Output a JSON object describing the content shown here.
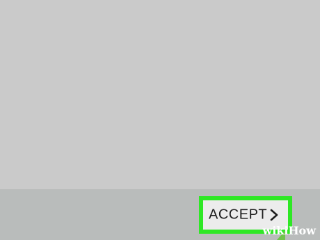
{
  "dialog": {
    "accept_label": "ACCEPT"
  },
  "icons": {
    "accept_chevron": "chevron-right-icon"
  },
  "watermark": {
    "wiki": "wiki",
    "how": "How"
  },
  "colors": {
    "background": "#c9c9c9",
    "bottom_bar": "#b9bcbb",
    "highlight": "#2ee825",
    "button_bg": "#ececec"
  }
}
